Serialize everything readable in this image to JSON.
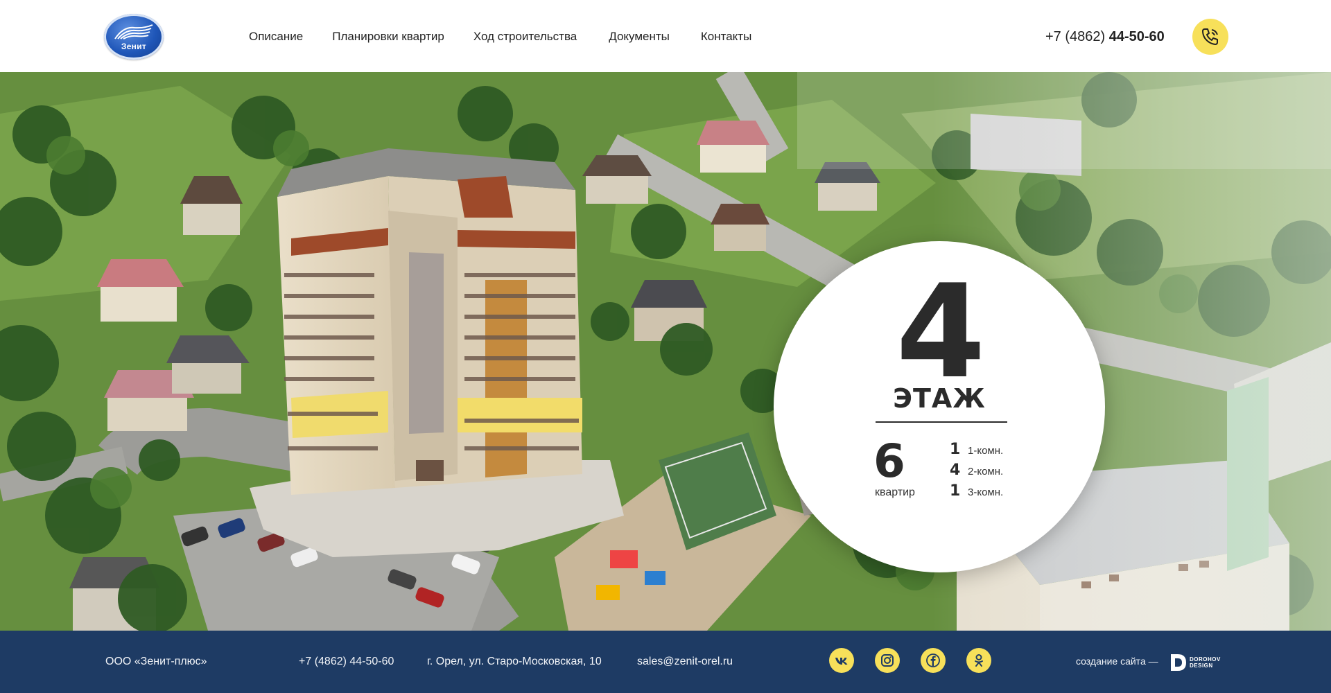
{
  "header": {
    "logo_text": "Зенит",
    "nav": [
      "Описание",
      "Планировки квартир",
      "Ход строительства",
      "Документы",
      "Контакты"
    ],
    "phone_prefix": "+7 (4862)",
    "phone_number": "44-50-60",
    "call_icon": "phone-icon"
  },
  "floor": {
    "number": "4",
    "word": "ЭТАЖ",
    "apartments_count": "6",
    "apartments_label": "квартир",
    "types": [
      {
        "count": "1",
        "label": "1-комн."
      },
      {
        "count": "4",
        "label": "2-комн."
      },
      {
        "count": "1",
        "label": "3-комн."
      }
    ]
  },
  "footer": {
    "company": "ООО «Зенит-плюс»",
    "phone": "+7 (4862) 44-50-60",
    "address": "г. Орел, ул. Старо-Московская, 10",
    "email": "sales@zenit-orel.ru",
    "socials": [
      "vk-icon",
      "instagram-icon",
      "facebook-icon",
      "odnoklassniki-icon"
    ],
    "made_by_label": "создание сайта —",
    "studio_line1": "DOROHOV",
    "studio_line2": "DESIGN"
  },
  "colors": {
    "accent_yellow": "#f7e05a",
    "footer_blue": "#1e3b64",
    "text_dark": "#2b2b2b"
  }
}
